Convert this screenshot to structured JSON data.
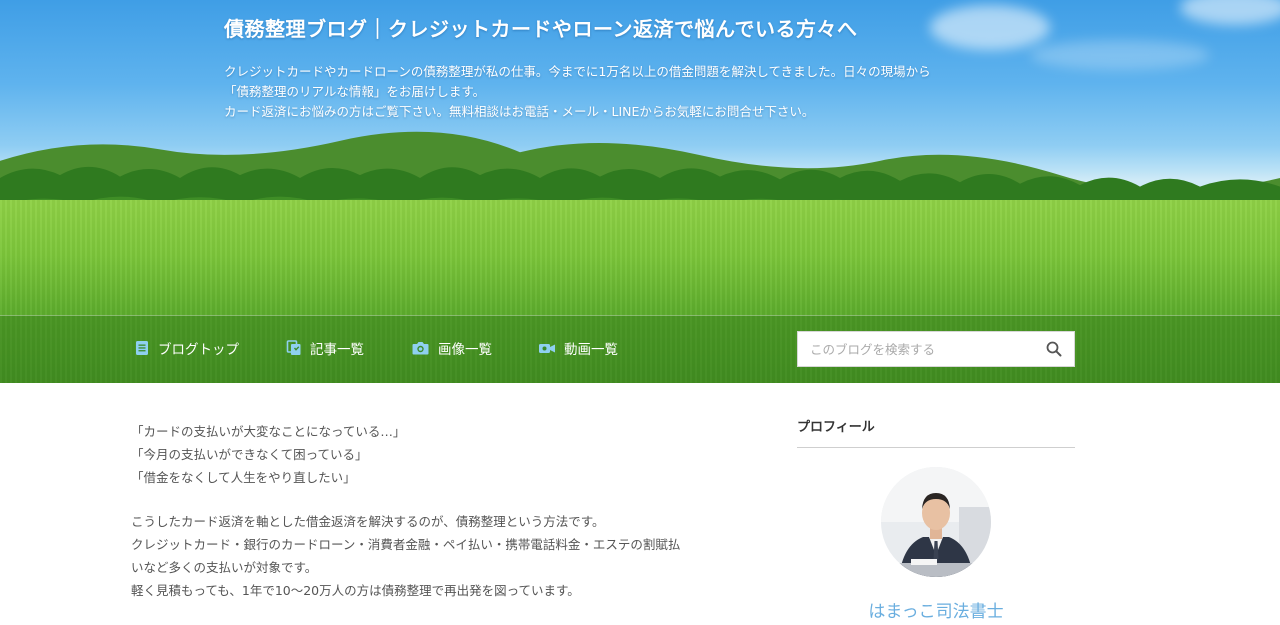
{
  "header": {
    "title": "債務整理ブログ｜クレジットカードやローン返済で悩んでいる方々へ",
    "description_lines": [
      "クレジットカードやカードローンの債務整理が私の仕事。今までに1万名以上の借金問題を解決してきました。日々の現場から",
      "「債務整理のリアルな情報」をお届けします。",
      "カード返済にお悩みの方はご覧下さい。無料相談はお電話・メール・LINEからお気軽にお問合せ下さい。"
    ]
  },
  "nav": {
    "items": [
      {
        "label": "ブログトップ",
        "icon": "document-icon"
      },
      {
        "label": "記事一覧",
        "icon": "copy-icon"
      },
      {
        "label": "画像一覧",
        "icon": "camera-icon"
      },
      {
        "label": "動画一覧",
        "icon": "video-camera-icon"
      }
    ],
    "search": {
      "placeholder": "このブログを検索する",
      "icon": "search-icon"
    }
  },
  "article": {
    "paragraphs": [
      [
        "「カードの支払いが大変なことになっている…」",
        "「今月の支払いができなくて困っている」",
        "「借金をなくして人生をやり直したい」"
      ],
      [
        "こうしたカード返済を軸とした借金返済を解決するのが、債務整理という方法です。",
        "クレジットカード・銀行のカードローン・消費者金融・ペイ払い・携帯電話料金・エステの割賦払",
        "いなど多くの支払いが対象です。",
        "軽く見積もっても、1年で10〜20万人の方は債務整理で再出発を図っています。"
      ]
    ]
  },
  "sidebar": {
    "heading": "プロフィール",
    "profile_name": "はまっこ司法書士"
  },
  "colors": {
    "sky": "#4aa6e8",
    "field": "#6fbe35",
    "link": "#6aaedf",
    "nav_icon": "#8fd0f0"
  }
}
